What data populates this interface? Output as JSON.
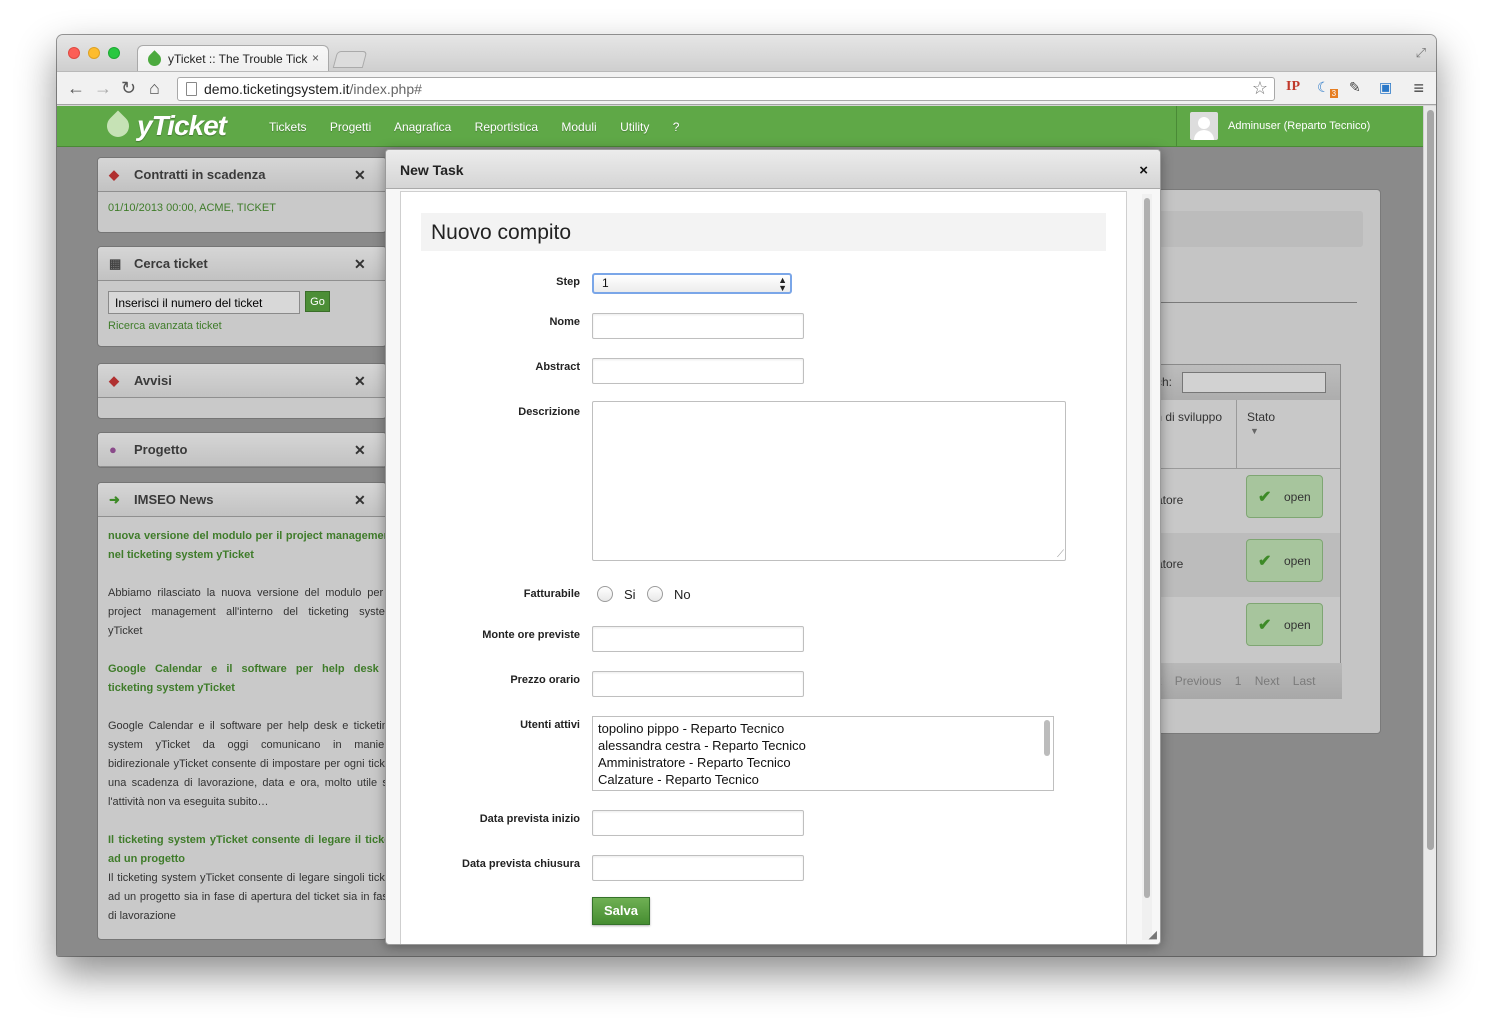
{
  "browser": {
    "tab_title": "yTicket :: The Trouble Tick",
    "tab_close": "×",
    "url_host": "demo.ticketingsystem.it",
    "url_path": "/index.php#",
    "ext_ip": "IP",
    "ext_badge": "3"
  },
  "app": {
    "logo": "yTicket",
    "menu": [
      "Tickets",
      "Progetti",
      "Anagrafica",
      "Reportistica",
      "Moduli",
      "Utility",
      "?"
    ],
    "user": "Adminuser (Reparto Tecnico)"
  },
  "widgets": {
    "contratti": {
      "title": "Contratti in scadenza",
      "item": "01/10/2013 00:00, ACME, TICKET"
    },
    "cerca": {
      "title": "Cerca ticket",
      "input_value": "Inserisci il numero del ticket",
      "go": "Go",
      "advanced": "Ricerca avanzata ticket"
    },
    "avvisi": {
      "title": "Avvisi"
    },
    "progetto": {
      "title": "Progetto"
    },
    "news": {
      "title": "IMSEO News",
      "items": [
        {
          "title": "nuova versione del modulo per il project management nel ticketing system yTicket",
          "body": "Abbiamo rilasciato la nuova versione del modulo per il project management all'interno del ticketing system yTicket"
        },
        {
          "title": "Google Calendar e il software per help desk e ticketing system yTicket",
          "body": "Google Calendar e il software per help desk e ticketing system yTicket da oggi comunicano in maniera bidirezionale yTicket consente di impostare per ogni ticket una scadenza di lavorazione, data e ora, molto utile se l'attività non va eseguita subito…"
        },
        {
          "title": "Il ticketing system yTicket consente di legare il ticket ad un progetto",
          "body": "Il ticketing system yTicket consente di  legare singoli ticket ad un progetto sia in fase di apertura del ticket sia in fase di lavorazione"
        }
      ]
    }
  },
  "right_panel": {
    "search_label": "rch:",
    "col1": "m di sviluppo",
    "col2": "Stato",
    "rows": [
      {
        "cell": "ratore",
        "status": "open"
      },
      {
        "cell": "ratore",
        "status": "open"
      },
      {
        "cell": "",
        "status": "open"
      }
    ],
    "pager": [
      "st",
      "Previous",
      "1",
      "Next",
      "Last"
    ]
  },
  "modal": {
    "title": "New Task",
    "close": "×",
    "form_title": "Nuovo compito",
    "labels": {
      "step": "Step",
      "nome": "Nome",
      "abstract": "Abstract",
      "descrizione": "Descrizione",
      "fatturabile": "Fatturabile",
      "monte_ore": "Monte ore previste",
      "prezzo": "Prezzo orario",
      "utenti": "Utenti attivi",
      "data_inizio": "Data prevista inizio",
      "data_chiusura": "Data prevista chiusura"
    },
    "step_value": "1",
    "radio_si": "Si",
    "radio_no": "No",
    "utenti": [
      "topolino pippo - Reparto Tecnico",
      "alessandra cestra - Reparto Tecnico",
      "Amministratore - Reparto Tecnico",
      "Calzature - Reparto Tecnico"
    ],
    "save": "Salva"
  }
}
